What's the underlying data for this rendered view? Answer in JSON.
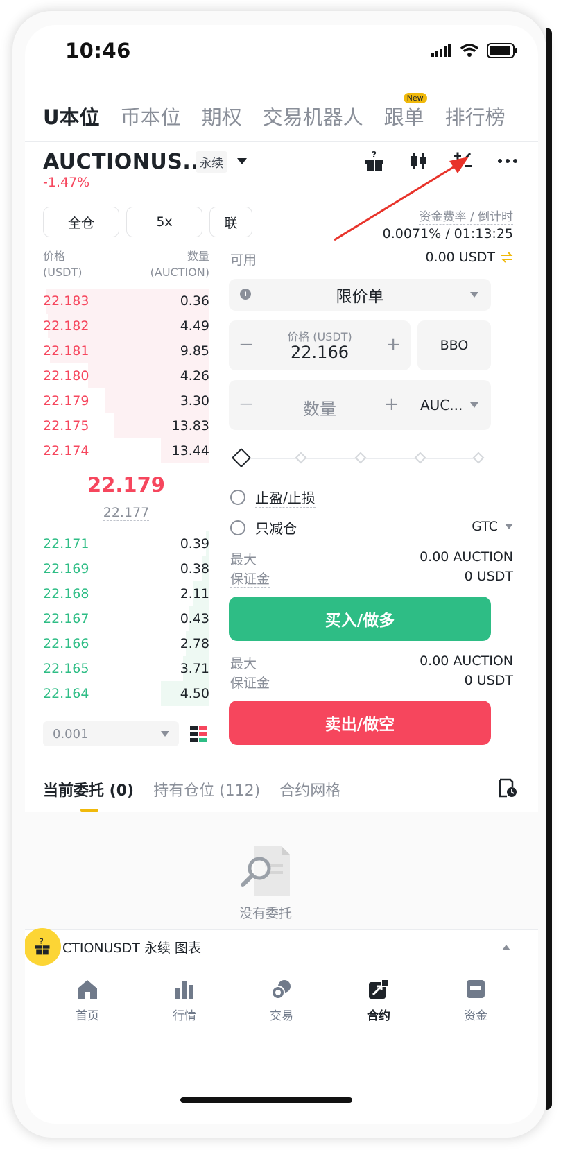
{
  "status": {
    "time": "10:46"
  },
  "tabs": [
    {
      "label": "U本位",
      "active": true
    },
    {
      "label": "币本位"
    },
    {
      "label": "期权"
    },
    {
      "label": "交易机器人"
    },
    {
      "label": "跟单",
      "badge": "New"
    },
    {
      "label": "排行榜"
    }
  ],
  "pair": {
    "name": "AUCTIONUS...",
    "type": "永续",
    "change": "-1.47%"
  },
  "chips": {
    "margin_mode": "全仓",
    "leverage": "5x",
    "link": "联"
  },
  "funding": {
    "label": "资金费率 / 倒计时",
    "value": "0.0071% / 01:13:25"
  },
  "orderbook": {
    "price_header": "价格",
    "price_unit": "(USDT)",
    "qty_header": "数量",
    "qty_unit": "(AUCTION)",
    "asks": [
      {
        "price": "22.183",
        "qty": "0.36",
        "depth": 0.98
      },
      {
        "price": "22.182",
        "qty": "4.49",
        "depth": 0.97
      },
      {
        "price": "22.181",
        "qty": "9.85",
        "depth": 0.96
      },
      {
        "price": "22.180",
        "qty": "4.26",
        "depth": 0.73
      },
      {
        "price": "22.179",
        "qty": "3.30",
        "depth": 0.63
      },
      {
        "price": "22.175",
        "qty": "13.83",
        "depth": 0.57
      },
      {
        "price": "22.174",
        "qty": "13.44",
        "depth": 0.29
      }
    ],
    "last_price": "22.179",
    "mark_price": "22.177",
    "bids": [
      {
        "price": "22.171",
        "qty": "0.39",
        "depth": 0.02
      },
      {
        "price": "22.169",
        "qty": "0.38",
        "depth": 0.04
      },
      {
        "price": "22.168",
        "qty": "2.11",
        "depth": 0.1
      },
      {
        "price": "22.167",
        "qty": "0.43",
        "depth": 0.12
      },
      {
        "price": "22.166",
        "qty": "2.78",
        "depth": 0.14
      },
      {
        "price": "22.165",
        "qty": "3.71",
        "depth": 0.16
      },
      {
        "price": "22.164",
        "qty": "4.50",
        "depth": 0.29
      }
    ],
    "precision": "0.001"
  },
  "order_form": {
    "available_label": "可用",
    "available_value": "0.00 USDT",
    "order_type": "限价单",
    "price_label": "价格 (USDT)",
    "price_value": "22.166",
    "bbo": "BBO",
    "qty_placeholder": "数量",
    "qty_unit": "AUC...",
    "tpsl": "止盈/止损",
    "reduce_only": "只减仓",
    "tif": "GTC",
    "buy_info": {
      "max_label": "最大",
      "max_value": "0.00 AUCTION",
      "margin_label": "保证金",
      "margin_value": "0 USDT"
    },
    "buy_label": "买入/做多",
    "sell_info": {
      "max_label": "最大",
      "max_value": "0.00 AUCTION",
      "margin_label": "保证金",
      "margin_value": "0 USDT"
    },
    "sell_label": "卖出/做空"
  },
  "bottom_tabs": [
    {
      "label": "当前委托 (0)",
      "active": true
    },
    {
      "label": "持有仓位 (112)"
    },
    {
      "label": "合约网格"
    }
  ],
  "empty_text": "没有委托",
  "chart_bar": {
    "label": "CTIONUSDT 永续  图表"
  },
  "nav": [
    {
      "label": "首页",
      "icon": "home-icon"
    },
    {
      "label": "行情",
      "icon": "markets-icon"
    },
    {
      "label": "交易",
      "icon": "trade-icon"
    },
    {
      "label": "合约",
      "icon": "futures-icon",
      "active": true
    },
    {
      "label": "资金",
      "icon": "wallet-icon"
    }
  ],
  "colors": {
    "red": "#f6465d",
    "green": "#2ebd85",
    "accent": "#f0b90b"
  }
}
